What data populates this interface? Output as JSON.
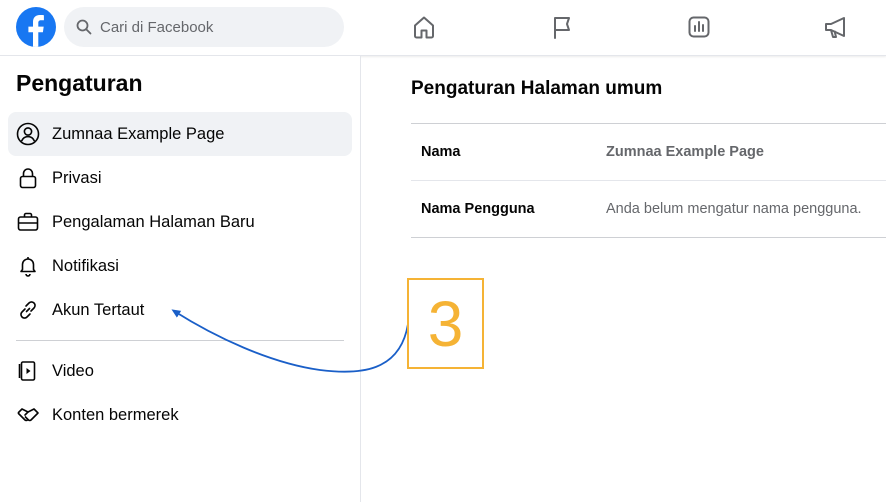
{
  "search": {
    "placeholder": "Cari di Facebook"
  },
  "sidebar": {
    "title": "Pengaturan",
    "items": [
      {
        "label": "Zumnaa Example Page",
        "icon": "profile-icon",
        "active": true
      },
      {
        "label": "Privasi",
        "icon": "lock-icon"
      },
      {
        "label": "Pengalaman Halaman Baru",
        "icon": "briefcase-icon"
      },
      {
        "label": "Notifikasi",
        "icon": "bell-icon"
      },
      {
        "label": "Akun Tertaut",
        "icon": "link-icon"
      },
      {
        "label": "Video",
        "icon": "video-icon"
      },
      {
        "label": "Konten bermerek",
        "icon": "handshake-icon"
      }
    ]
  },
  "main": {
    "title": "Pengaturan Halaman umum",
    "rows": [
      {
        "key": "Nama",
        "value": "Zumnaa Example Page"
      },
      {
        "key": "Nama Pengguna",
        "value": "Anda belum mengatur nama pengguna."
      }
    ]
  },
  "annotation": {
    "step_number": "3"
  },
  "colors": {
    "brand": "#1877f2",
    "annotation_border": "#f5b335",
    "arrow": "#1a5fc8"
  }
}
